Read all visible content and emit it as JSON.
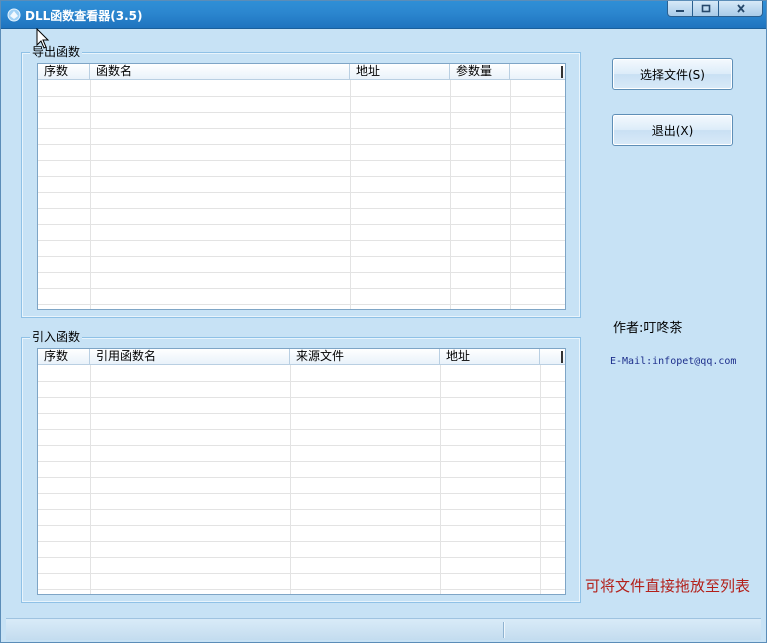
{
  "window": {
    "title": "DLL函数查看器(3.5)"
  },
  "export_group": {
    "label": "导出函数",
    "columns": [
      "序数",
      "函数名",
      "地址",
      "参数量"
    ]
  },
  "import_group": {
    "label": "引入函数",
    "columns": [
      "序数",
      "引用函数名",
      "来源文件",
      "地址"
    ]
  },
  "buttons": {
    "select_file": "选择文件(S)",
    "exit": "退出(X)"
  },
  "info": {
    "author": "作者:叮咚茶",
    "email": "E-Mail:infopet@qq.com",
    "hint": "可将文件直接拖放至列表"
  },
  "colors": {
    "titlebar": "#2b86cf",
    "window_bg": "#c7e2f5",
    "hint_text": "#b3201a",
    "email_text": "#1d2f8c"
  }
}
